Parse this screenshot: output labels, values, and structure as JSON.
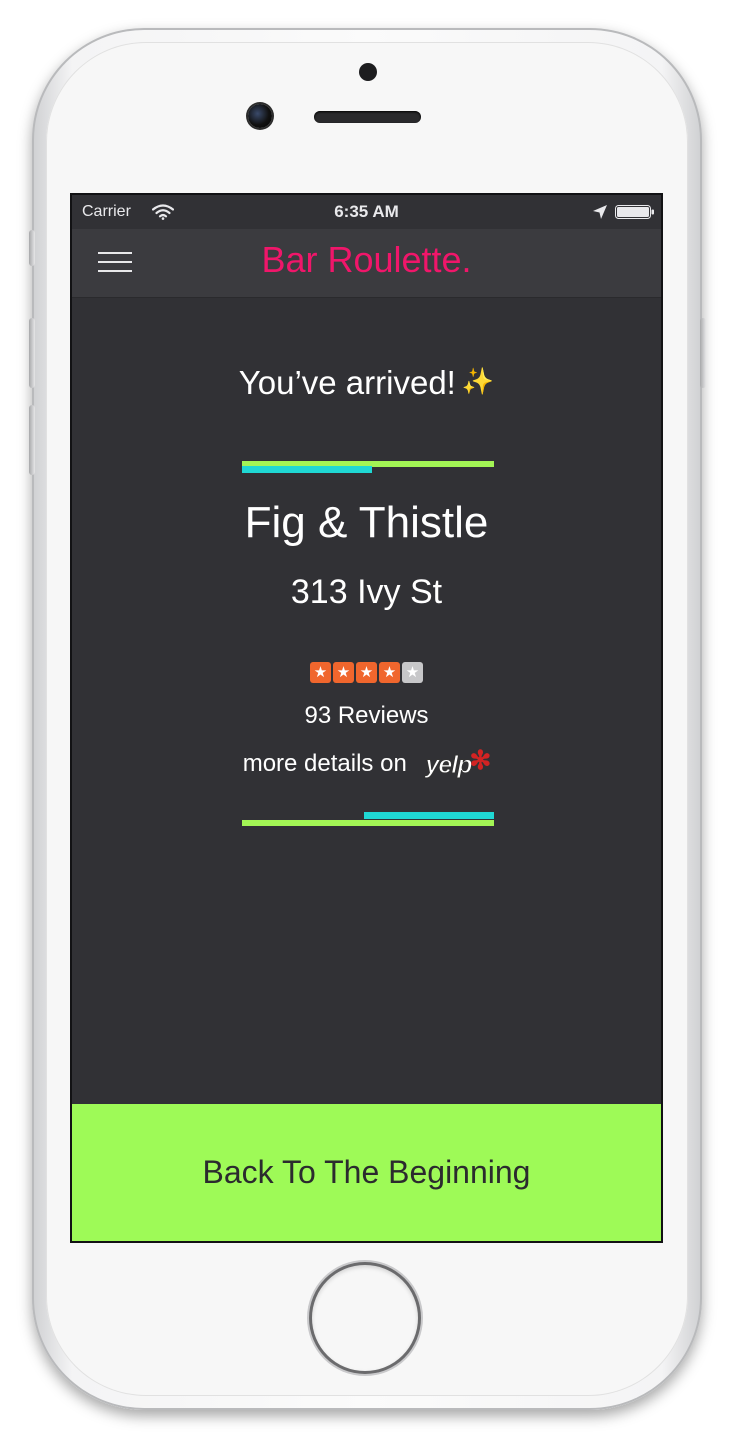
{
  "statusbar": {
    "carrier": "Carrier",
    "time": "6:35 AM"
  },
  "navbar": {
    "title": "Bar Roulette."
  },
  "main": {
    "arrived_text": "You’ve arrived!",
    "arrived_emoji": "✨",
    "bar_name": "Fig & Thistle",
    "address": "313 Ivy St",
    "rating": {
      "value": 4,
      "max": 5
    },
    "reviews": "93 Reviews",
    "details_text": "more details on",
    "yelp_logo": "yelp"
  },
  "cta": {
    "label": "Back To The Beginning"
  },
  "colors": {
    "background": "#313135",
    "navbar": "#3b3b3f",
    "title_pink": "#f0166a",
    "accent_green": "#a3f555",
    "accent_cyan": "#1fd8d4",
    "button_green": "#9efa57",
    "star_orange": "#f0662d",
    "star_empty": "#c7c7c9"
  }
}
